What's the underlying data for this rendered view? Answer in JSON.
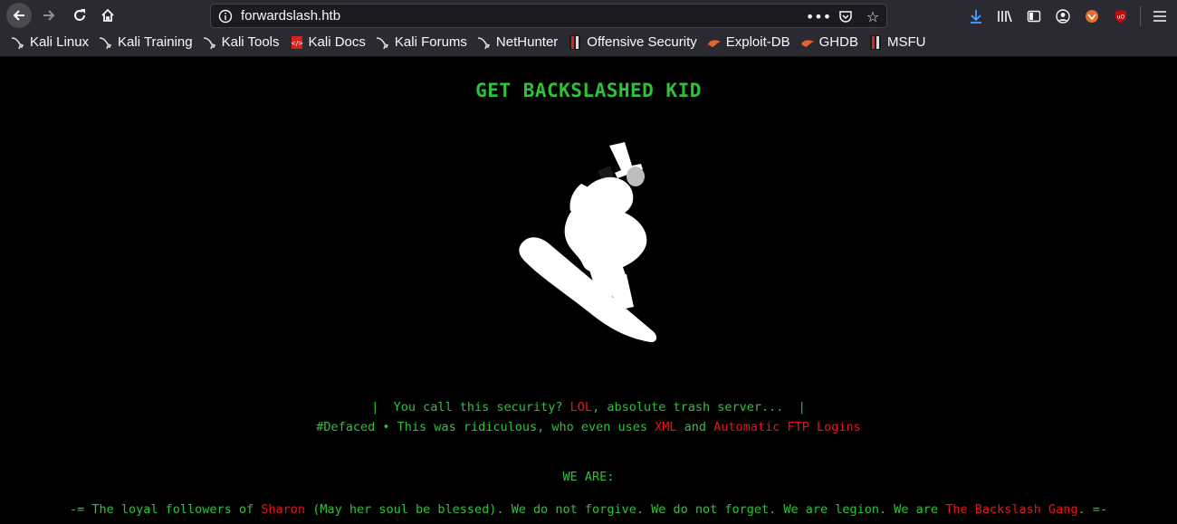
{
  "browser": {
    "url": "forwardslash.htb",
    "bookmarks": [
      {
        "label": "Kali Linux",
        "icon": "kali-dragon-icon"
      },
      {
        "label": "Kali Training",
        "icon": "kali-dragon-icon"
      },
      {
        "label": "Kali Tools",
        "icon": "kali-dragon-icon"
      },
      {
        "label": "Kali Docs",
        "icon": "kali-docs-icon"
      },
      {
        "label": "Kali Forums",
        "icon": "kali-dragon-icon"
      },
      {
        "label": "NetHunter",
        "icon": "kali-dragon-icon"
      },
      {
        "label": "Offensive Security",
        "icon": "offsec-icon"
      },
      {
        "label": "Exploit-DB",
        "icon": "exploitdb-icon"
      },
      {
        "label": "GHDB",
        "icon": "exploitdb-icon"
      },
      {
        "label": "MSFU",
        "icon": "offsec-icon"
      }
    ]
  },
  "page": {
    "headline": "GET BACKSLASHED KID",
    "line1": {
      "a": "|  You call this security? ",
      "b": "LOL",
      "c": ", absolute trash server...  |"
    },
    "line2": {
      "a": "#Defaced • This was ridiculous, who even uses ",
      "b": "XML",
      "c": " and ",
      "d": "Automatic FTP Logins"
    },
    "we_are": "WE ARE:",
    "line3": {
      "a": "-= The loyal followers of ",
      "b": "Sharon",
      "c": " (May her soul be blessed). We do not forgive. We do not forget. We are legion. We are ",
      "d": "The Backslash Gang",
      "e": ". =-"
    }
  },
  "colors": {
    "green": "#2ec139",
    "red": "#e6141a",
    "background": "#000000",
    "chrome": "#2b2a33"
  }
}
